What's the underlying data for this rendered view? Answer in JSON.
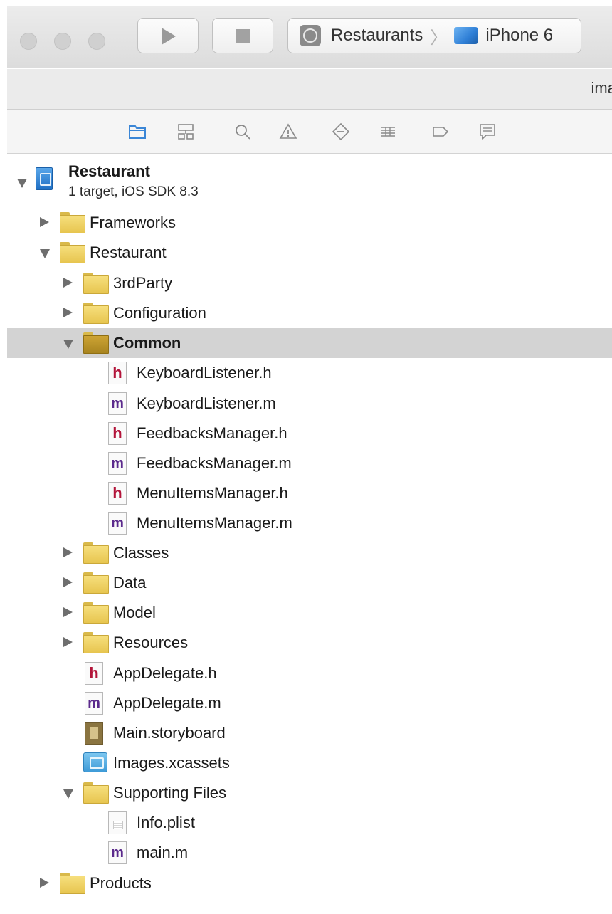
{
  "toolbar": {
    "scheme_target": "Restaurants",
    "scheme_device": "iPhone 6",
    "icons": [
      "play-icon",
      "stop-icon",
      "app-icon",
      "iphone-device-icon"
    ]
  },
  "title_strip": {
    "partial_text": "ima"
  },
  "navigator": {
    "icons": [
      "folder-icon",
      "hierarchy-icon",
      "search-icon",
      "warning-icon",
      "test-diamond-icon",
      "debug-list-icon",
      "breakpoint-icon",
      "report-icon"
    ],
    "accent_color": "#3b86d6"
  },
  "project": {
    "name": "Restaurant",
    "subtitle": "1 target, iOS SDK 8.3"
  },
  "tree": [
    {
      "label": "Frameworks",
      "kind": "folder",
      "state": "collapsed"
    },
    {
      "label": "Restaurant",
      "kind": "folder",
      "state": "expanded"
    },
    {
      "label": "3rdParty",
      "kind": "folder",
      "state": "collapsed"
    },
    {
      "label": "Configuration",
      "kind": "folder",
      "state": "collapsed"
    },
    {
      "label": "Common",
      "kind": "folder",
      "state": "expanded",
      "selected": true
    },
    {
      "label": "KeyboardListener.h",
      "kind": "h"
    },
    {
      "label": "KeyboardListener.m",
      "kind": "m"
    },
    {
      "label": "FeedbacksManager.h",
      "kind": "h"
    },
    {
      "label": "FeedbacksManager.m",
      "kind": "m"
    },
    {
      "label": "MenuItemsManager.h",
      "kind": "h"
    },
    {
      "label": "MenuItemsManager.m",
      "kind": "m"
    },
    {
      "label": "Classes",
      "kind": "folder",
      "state": "collapsed"
    },
    {
      "label": "Data",
      "kind": "folder",
      "state": "collapsed"
    },
    {
      "label": "Model",
      "kind": "folder",
      "state": "collapsed"
    },
    {
      "label": "Resources",
      "kind": "folder",
      "state": "collapsed"
    },
    {
      "label": "AppDelegate.h",
      "kind": "h"
    },
    {
      "label": "AppDelegate.m",
      "kind": "m"
    },
    {
      "label": "Main.storyboard",
      "kind": "storyboard"
    },
    {
      "label": "Images.xcassets",
      "kind": "xcassets"
    },
    {
      "label": "Supporting Files",
      "kind": "folder",
      "state": "expanded"
    },
    {
      "label": "Info.plist",
      "kind": "plist"
    },
    {
      "label": "main.m",
      "kind": "m"
    },
    {
      "label": "Products",
      "kind": "folder",
      "state": "collapsed"
    }
  ],
  "file_glyphs": {
    "h": "h",
    "m": "m"
  }
}
